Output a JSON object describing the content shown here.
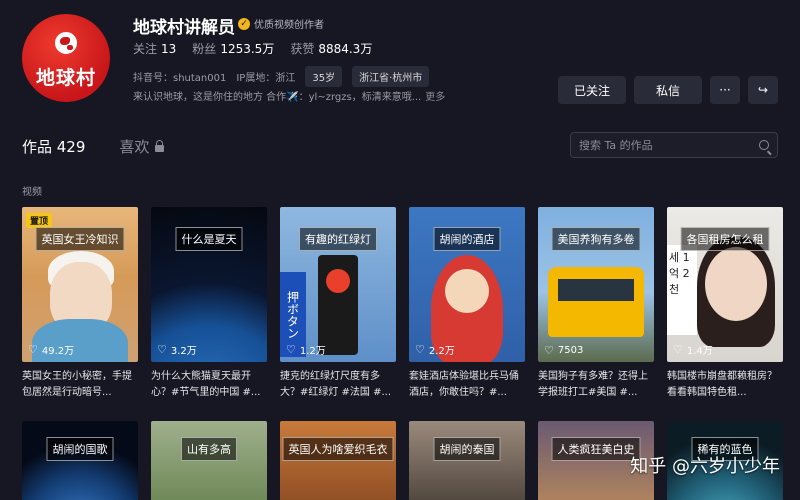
{
  "profile": {
    "logo_text": "地球村",
    "name": "地球村讲解员",
    "badge": "优质视频创作者",
    "stats": [
      {
        "label": "关注",
        "value": "13"
      },
      {
        "label": "粉丝",
        "value": "1253.5万"
      },
      {
        "label": "获赞",
        "value": "8884.3万"
      }
    ],
    "douyin_id": "抖音号：shutan001",
    "ip": "IP属地：浙江",
    "age_tag": "35岁",
    "location_tag": "浙江省·杭州市",
    "bio": "来认识地球，这是你住的地方 合作✈️：yl~zrgzs，标清来意哦...",
    "more": "更多"
  },
  "actions": {
    "follow": "已关注",
    "message": "私信",
    "more": "···",
    "share": "↪"
  },
  "tabs": {
    "works": "作品 429",
    "likes": "喜欢"
  },
  "search": {
    "placeholder": "搜索 Ta 的作品"
  },
  "section_label": "视频",
  "videos": [
    {
      "caption": "英国女王冷知识",
      "pin": "置顶",
      "likes": "49.2万",
      "title": "英国女王的小秘密，手提包居然是行动暗号..."
    },
    {
      "caption": "什么是夏天",
      "likes": "3.2万",
      "title": "为什么大熊猫夏天最开心？#节气里的中国 #..."
    },
    {
      "caption": "有趣的红绿灯",
      "likes": "1.2万",
      "sign": "押ボタン",
      "title": "捷克的红绿灯尺度有多大？#红绿灯 #法国 #..."
    },
    {
      "caption": "胡闹的酒店",
      "likes": "2.2万",
      "title": "套娃酒店体验堪比兵马俑酒店，你敢住吗？#..."
    },
    {
      "caption": "美国养狗有多卷",
      "likes": "7503",
      "title": "美国狗子有多难？还得上学报班打工#美国 #..."
    },
    {
      "caption": "各国租房怎么租",
      "likes": "1.4万",
      "paper": "세 1억 2천",
      "title": "韩国楼市崩盘都赖租房？看看韩国特色租..."
    },
    {
      "caption": "胡闹的国歌"
    },
    {
      "caption": "山有多高"
    },
    {
      "caption": "英国人为啥爱织毛衣"
    },
    {
      "caption": "胡闹的泰国"
    },
    {
      "caption": "人类疯狂美白史"
    },
    {
      "caption": "稀有的蓝色"
    }
  ],
  "watermark": "知乎 @六岁小少年",
  "colors": {
    "background": "#161722",
    "accent_red": "#c8161a",
    "badge_gold": "#f5b51b",
    "pin_yellow": "#f5c518"
  }
}
